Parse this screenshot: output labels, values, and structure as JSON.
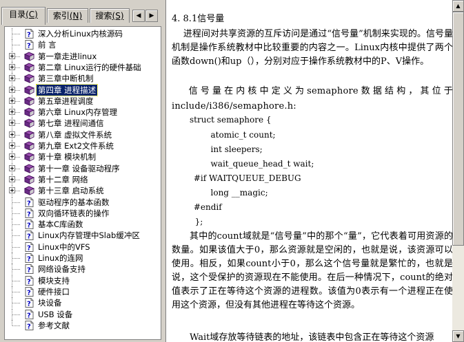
{
  "tabs": [
    {
      "label": "目录",
      "key": "(C)",
      "active": true
    },
    {
      "label": "索引",
      "key": "(N)",
      "active": false
    },
    {
      "label": "搜索",
      "key": "(S)",
      "active": false
    }
  ],
  "tab_nav": {
    "left": "◀",
    "right": "▶"
  },
  "tree": [
    {
      "label": "深入分析Linux内核源码",
      "type": "page",
      "expandable": false
    },
    {
      "label": "前  言",
      "type": "page",
      "expandable": false
    },
    {
      "label": "第一章走进linux",
      "type": "book",
      "expandable": true
    },
    {
      "label": "第二章 Linux运行的硬件基础",
      "type": "book",
      "expandable": true
    },
    {
      "label": "第三章中断机制",
      "type": "book",
      "expandable": true
    },
    {
      "label": "第四章  进程描述",
      "type": "book",
      "expandable": true,
      "selected": true
    },
    {
      "label": "第五章进程调度",
      "type": "book",
      "expandable": true
    },
    {
      "label": "第六章 Linux内存管理",
      "type": "book",
      "expandable": true
    },
    {
      "label": "第七章  进程间通信",
      "type": "book",
      "expandable": true
    },
    {
      "label": "第八章 虚拟文件系统",
      "type": "book",
      "expandable": true
    },
    {
      "label": "第九章 Ext2文件系统",
      "type": "book",
      "expandable": true
    },
    {
      "label": "第十章  模块机制",
      "type": "book",
      "expandable": true
    },
    {
      "label": "第十一章  设备驱动程序",
      "type": "book",
      "expandable": true
    },
    {
      "label": "第十二章  网络",
      "type": "book",
      "expandable": true
    },
    {
      "label": "第十三章  启动系统",
      "type": "book",
      "expandable": true
    },
    {
      "label": "驱动程序的基本函数",
      "type": "page",
      "expandable": false
    },
    {
      "label": "双向循环链表的操作",
      "type": "page",
      "expandable": false
    },
    {
      "label": "基本C库函数",
      "type": "page",
      "expandable": false
    },
    {
      "label": "Linux内存管理中Slab缓冲区",
      "type": "page",
      "expandable": false
    },
    {
      "label": "Linux中的VFS",
      "type": "page",
      "expandable": false
    },
    {
      "label": "Linux的连网",
      "type": "page",
      "expandable": false
    },
    {
      "label": "网络设备支持",
      "type": "page",
      "expandable": false
    },
    {
      "label": "模块支持",
      "type": "page",
      "expandable": false
    },
    {
      "label": "硬件接口",
      "type": "page",
      "expandable": false
    },
    {
      "label": "块设备",
      "type": "page",
      "expandable": false
    },
    {
      "label": "USB 设备",
      "type": "page",
      "expandable": false
    },
    {
      "label": "参考文献",
      "type": "page",
      "expandable": false
    }
  ],
  "content": {
    "heading": "4. 8.1信号量",
    "para1": "进程间对共享资源的互斥访问是通过“信号量”机制来实现的。信号量机制是操作系统教材中比较重要的内容之一。Linux内核中提供了两个函数down()和up（），分别对应于操作系统教材中的P、V操作。",
    "para2": "信号量在内核中定义为semaphore数据结构，其位于include/i386/semaphore.h:",
    "code": [
      "struct semaphore {",
      "        atomic_t count;",
      "        int sleepers;",
      "        wait_queue_head_t wait;",
      " #if WAITQUEUE_DEBUG",
      "        long __magic;",
      " #endif",
      "  };"
    ],
    "para3": "其中的count域就是“信号量”中的那个“量”，它代表着可用资源的数量。如果该值大于0，那么资源就是空闲的，也就是说，该资源可以使用。相反，如果count小于0，那么这个信号量就是繁忙的，也就是说，这个受保护的资源现在不能使用。在后一种情况下，count的绝对值表示了正在等待这个资源的进程数。该值为0表示有一个进程正在使用这个资源，但没有其他进程在等待这个资源。",
    "para4": "Wait域存放等待链表的地址，该链表中包含正在等待这个资源"
  },
  "scroll": {
    "up": "▲",
    "down": "▼"
  }
}
